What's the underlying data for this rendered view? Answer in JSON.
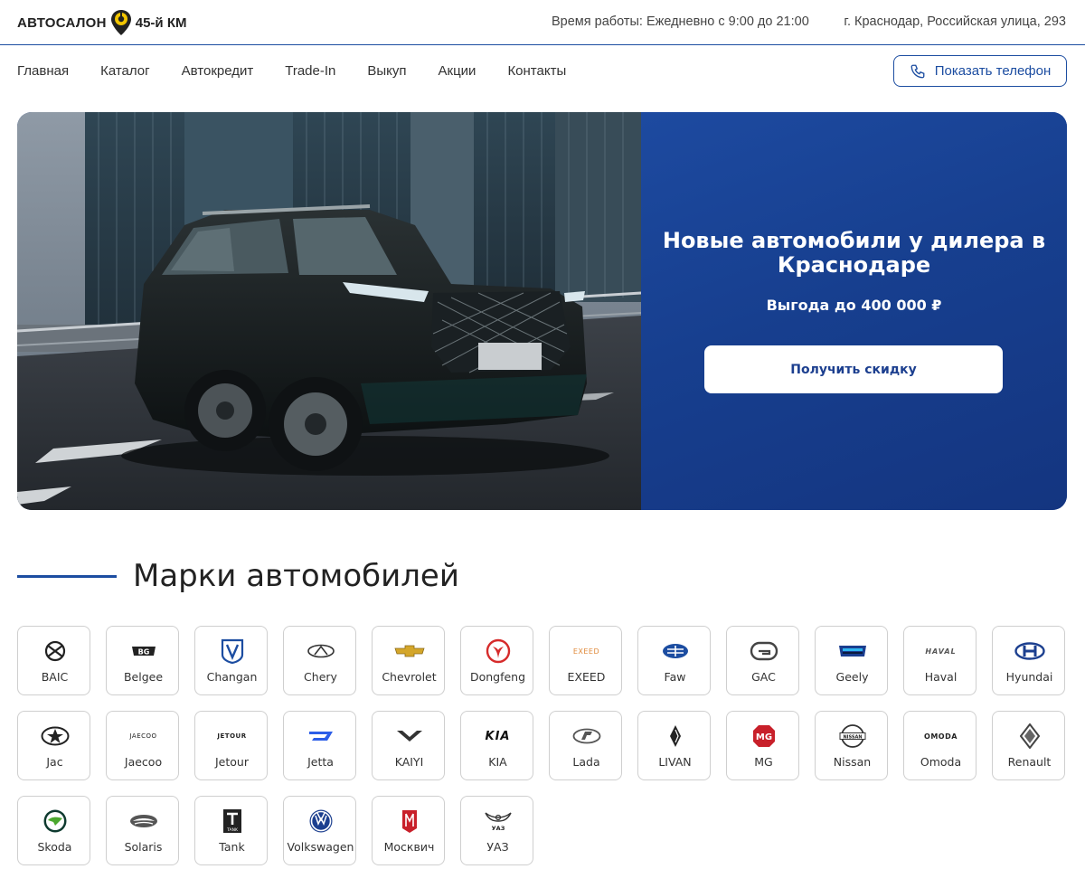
{
  "header": {
    "logo_left": "АВТОСАЛОН",
    "logo_right": "45-й КМ",
    "hours": "Время работы: Ежедневно с 9:00 до 21:00",
    "address": "г. Краснодар, Российская улица, 293"
  },
  "nav": {
    "items": [
      "Главная",
      "Каталог",
      "Автокредит",
      "Trade-In",
      "Выкуп",
      "Акции",
      "Контакты"
    ],
    "phone_button": "Показать телефон"
  },
  "hero": {
    "title": "Новые автомобили у дилера в Краснодаре",
    "subtitle": "Выгода до 400 000 ₽",
    "button": "Получить скидку"
  },
  "brands_section": {
    "title": "Марки автомобилей",
    "brands": [
      {
        "name": "BAIC",
        "icon": "baic-logo-icon"
      },
      {
        "name": "Belgee",
        "icon": "belgee-logo-icon"
      },
      {
        "name": "Changan",
        "icon": "changan-logo-icon"
      },
      {
        "name": "Chery",
        "icon": "chery-logo-icon"
      },
      {
        "name": "Chevrolet",
        "icon": "chevrolet-logo-icon"
      },
      {
        "name": "Dongfeng",
        "icon": "dongfeng-logo-icon"
      },
      {
        "name": "EXEED",
        "icon": "exeed-logo-icon"
      },
      {
        "name": "Faw",
        "icon": "faw-logo-icon"
      },
      {
        "name": "GAC",
        "icon": "gac-logo-icon"
      },
      {
        "name": "Geely",
        "icon": "geely-logo-icon"
      },
      {
        "name": "Haval",
        "icon": "haval-logo-icon"
      },
      {
        "name": "Hyundai",
        "icon": "hyundai-logo-icon"
      },
      {
        "name": "Jac",
        "icon": "jac-logo-icon"
      },
      {
        "name": "Jaecoo",
        "icon": "jaecoo-logo-icon"
      },
      {
        "name": "Jetour",
        "icon": "jetour-logo-icon"
      },
      {
        "name": "Jetta",
        "icon": "jetta-logo-icon"
      },
      {
        "name": "KAIYI",
        "icon": "kaiyi-logo-icon"
      },
      {
        "name": "KIA",
        "icon": "kia-logo-icon"
      },
      {
        "name": "Lada",
        "icon": "lada-logo-icon"
      },
      {
        "name": "LIVAN",
        "icon": "livan-logo-icon"
      },
      {
        "name": "MG",
        "icon": "mg-logo-icon"
      },
      {
        "name": "Nissan",
        "icon": "nissan-logo-icon"
      },
      {
        "name": "Omoda",
        "icon": "omoda-logo-icon"
      },
      {
        "name": "Renault",
        "icon": "renault-logo-icon"
      },
      {
        "name": "Skoda",
        "icon": "skoda-logo-icon"
      },
      {
        "name": "Solaris",
        "icon": "solaris-logo-icon"
      },
      {
        "name": "Tank",
        "icon": "tank-logo-icon"
      },
      {
        "name": "Volkswagen",
        "icon": "volkswagen-logo-icon"
      },
      {
        "name": "Москвич",
        "icon": "moskvich-logo-icon"
      },
      {
        "name": "УАЗ",
        "icon": "uaz-logo-icon"
      }
    ],
    "logo_texts": {
      "belgee": "BG",
      "exeed": "EXEED",
      "haval": "HAVAL",
      "jaecoo": "JAECOO",
      "jetour": "JETOUR",
      "kia": "KIA",
      "mg": "MG",
      "nissan": "NISSAN",
      "omoda": "OMODA",
      "tank": "TANK",
      "uaz": "УАЗ"
    }
  },
  "colors": {
    "brand_blue": "#1c4da1",
    "hero_panel": "#173f8f",
    "logo_yellow": "#f2c500"
  }
}
